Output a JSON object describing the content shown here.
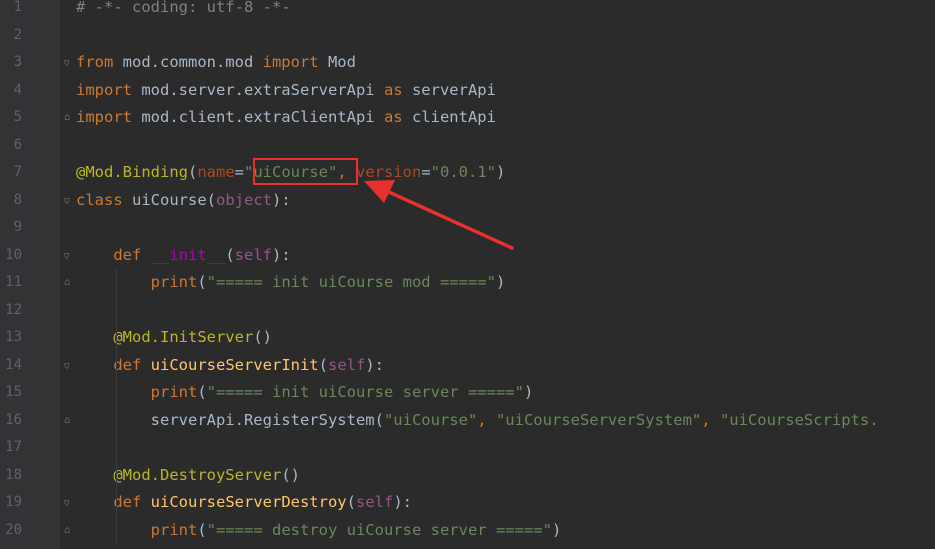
{
  "editor": {
    "lines": [
      {
        "n": "1",
        "fold": "",
        "tokens": [
          {
            "t": "# -*- coding: utf-8 -*-",
            "c": "cmt"
          }
        ]
      },
      {
        "n": "2",
        "fold": "",
        "tokens": []
      },
      {
        "n": "3",
        "fold": "open",
        "tokens": [
          {
            "t": "from",
            "c": "kw"
          },
          {
            "t": " mod.common.mod ",
            "c": "plain"
          },
          {
            "t": "import",
            "c": "kw"
          },
          {
            "t": " Mod",
            "c": "plain"
          }
        ]
      },
      {
        "n": "4",
        "fold": "",
        "tokens": [
          {
            "t": "import",
            "c": "kw"
          },
          {
            "t": " mod.server.extraServerApi ",
            "c": "plain"
          },
          {
            "t": "as",
            "c": "kw"
          },
          {
            "t": " serverApi",
            "c": "plain"
          }
        ]
      },
      {
        "n": "5",
        "fold": "close",
        "tokens": [
          {
            "t": "import",
            "c": "kw"
          },
          {
            "t": " mod.client.extraClientApi ",
            "c": "plain"
          },
          {
            "t": "as",
            "c": "kw"
          },
          {
            "t": " clientApi",
            "c": "plain"
          }
        ]
      },
      {
        "n": "6",
        "fold": "",
        "tokens": []
      },
      {
        "n": "7",
        "fold": "",
        "tokens": [
          {
            "t": "@Mod.Binding",
            "c": "deco"
          },
          {
            "t": "(",
            "c": "plain"
          },
          {
            "t": "name",
            "c": "param"
          },
          {
            "t": "=",
            "c": "plain"
          },
          {
            "t": "\"uiCourse\"",
            "c": "str"
          },
          {
            "t": ", ",
            "c": "kw"
          },
          {
            "t": "version",
            "c": "param"
          },
          {
            "t": "=",
            "c": "plain"
          },
          {
            "t": "\"0.0.1\"",
            "c": "str"
          },
          {
            "t": ")",
            "c": "plain"
          }
        ]
      },
      {
        "n": "8",
        "fold": "open",
        "tokens": [
          {
            "t": "class",
            "c": "kw"
          },
          {
            "t": " uiCourse(",
            "c": "plain"
          },
          {
            "t": "object",
            "c": "selfc"
          },
          {
            "t": "):",
            "c": "plain"
          }
        ]
      },
      {
        "n": "9",
        "fold": "",
        "tokens": []
      },
      {
        "n": "10",
        "fold": "open",
        "tokens": [
          {
            "t": "    ",
            "c": "plain"
          },
          {
            "t": "def",
            "c": "kw"
          },
          {
            "t": " ",
            "c": "plain"
          },
          {
            "t": "__init__",
            "c": "dunder"
          },
          {
            "t": "(",
            "c": "plain"
          },
          {
            "t": "self",
            "c": "selfc"
          },
          {
            "t": "):",
            "c": "plain"
          }
        ]
      },
      {
        "n": "11",
        "fold": "close",
        "tokens": [
          {
            "t": "        ",
            "c": "plain"
          },
          {
            "t": "print",
            "c": "kw"
          },
          {
            "t": "(",
            "c": "plain"
          },
          {
            "t": "\"===== init uiCourse mod =====\"",
            "c": "str"
          },
          {
            "t": ")",
            "c": "plain"
          }
        ]
      },
      {
        "n": "12",
        "fold": "",
        "tokens": []
      },
      {
        "n": "13",
        "fold": "",
        "tokens": [
          {
            "t": "    ",
            "c": "plain"
          },
          {
            "t": "@Mod.InitServer",
            "c": "deco"
          },
          {
            "t": "()",
            "c": "plain"
          }
        ]
      },
      {
        "n": "14",
        "fold": "open",
        "tokens": [
          {
            "t": "    ",
            "c": "plain"
          },
          {
            "t": "def",
            "c": "kw"
          },
          {
            "t": " ",
            "c": "plain"
          },
          {
            "t": "uiCourseServerInit",
            "c": "fn"
          },
          {
            "t": "(",
            "c": "plain"
          },
          {
            "t": "self",
            "c": "selfc"
          },
          {
            "t": "):",
            "c": "plain"
          }
        ]
      },
      {
        "n": "15",
        "fold": "",
        "tokens": [
          {
            "t": "        ",
            "c": "plain"
          },
          {
            "t": "print",
            "c": "kw"
          },
          {
            "t": "(",
            "c": "plain"
          },
          {
            "t": "\"===== init uiCourse server =====\"",
            "c": "str"
          },
          {
            "t": ")",
            "c": "plain"
          }
        ]
      },
      {
        "n": "16",
        "fold": "close",
        "tokens": [
          {
            "t": "        serverApi.RegisterSystem(",
            "c": "plain"
          },
          {
            "t": "\"uiCourse\"",
            "c": "str"
          },
          {
            "t": ", ",
            "c": "kw"
          },
          {
            "t": "\"uiCourseServerSystem\"",
            "c": "str"
          },
          {
            "t": ", ",
            "c": "kw"
          },
          {
            "t": "\"uiCourseScripts.",
            "c": "str"
          }
        ]
      },
      {
        "n": "17",
        "fold": "",
        "tokens": []
      },
      {
        "n": "18",
        "fold": "",
        "tokens": [
          {
            "t": "    ",
            "c": "plain"
          },
          {
            "t": "@Mod.DestroyServer",
            "c": "deco"
          },
          {
            "t": "()",
            "c": "plain"
          }
        ]
      },
      {
        "n": "19",
        "fold": "open",
        "tokens": [
          {
            "t": "    ",
            "c": "plain"
          },
          {
            "t": "def",
            "c": "kw"
          },
          {
            "t": " ",
            "c": "plain"
          },
          {
            "t": "uiCourseServerDestroy",
            "c": "fn"
          },
          {
            "t": "(",
            "c": "plain"
          },
          {
            "t": "self",
            "c": "selfc"
          },
          {
            "t": "):",
            "c": "plain"
          }
        ]
      },
      {
        "n": "20",
        "fold": "close",
        "tokens": [
          {
            "t": "        ",
            "c": "plain"
          },
          {
            "t": "print",
            "c": "kw"
          },
          {
            "t": "(",
            "c": "plain"
          },
          {
            "t": "\"===== destroy uiCourse server =====\"",
            "c": "str"
          },
          {
            "t": ")",
            "c": "plain"
          }
        ]
      }
    ]
  },
  "annotation": {
    "box_color": "#e8302c",
    "arrow_color": "#e8302c"
  }
}
